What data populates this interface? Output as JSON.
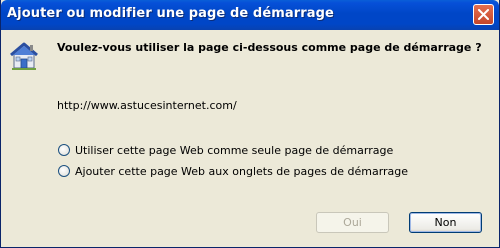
{
  "window": {
    "title": "Ajouter ou modifier une page de démarrage"
  },
  "dialog": {
    "question": "Voulez-vous utiliser la page ci-dessous comme page de démarrage ?",
    "url": "http://www.astucesinternet.com/",
    "options": [
      {
        "label": "Utiliser cette page Web comme seule page de démarrage",
        "selected": false
      },
      {
        "label": "Ajouter cette page Web aux onglets de pages de démarrage",
        "selected": false
      }
    ]
  },
  "buttons": {
    "yes_label": "Oui",
    "yes_enabled": false,
    "no_label": "Non"
  },
  "icons": {
    "title_close": "close-icon",
    "home": "house-icon"
  },
  "colors": {
    "titlebar": "#0046c7",
    "body": "#ece9d8",
    "close_button": "#d65a3a"
  }
}
